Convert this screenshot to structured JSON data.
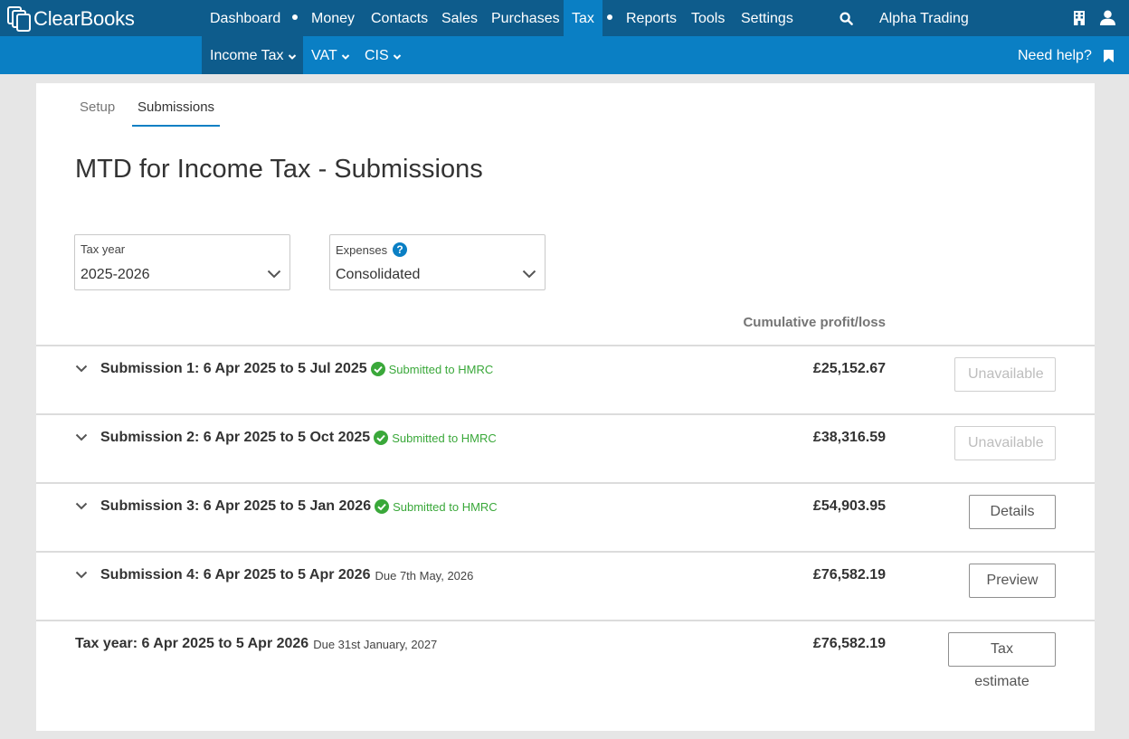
{
  "app": {
    "brand": "ClearBooks",
    "company": "Alpha Trading"
  },
  "topnav": {
    "items": [
      {
        "label": "Dashboard"
      },
      {
        "label": "Money"
      },
      {
        "label": "Contacts"
      },
      {
        "label": "Sales"
      },
      {
        "label": "Purchases"
      },
      {
        "label": "Tax"
      },
      {
        "label": "Reports"
      },
      {
        "label": "Tools"
      },
      {
        "label": "Settings"
      }
    ],
    "active": "Tax"
  },
  "subnav": {
    "items": [
      {
        "label": "Income Tax"
      },
      {
        "label": "VAT"
      },
      {
        "label": "CIS"
      }
    ],
    "active": "Income Tax",
    "help_label": "Need help?"
  },
  "tabs": [
    {
      "label": "Setup"
    },
    {
      "label": "Submissions"
    }
  ],
  "active_tab": "Submissions",
  "page_title": "MTD for Income Tax - Submissions",
  "filters": {
    "tax_year": {
      "label": "Tax year",
      "value": "2025-2026"
    },
    "expenses": {
      "label": "Expenses",
      "value": "Consolidated"
    }
  },
  "table": {
    "column_header": "Cumulative profit/loss",
    "rows": [
      {
        "label": "Submission 1: 6 Apr 2025 to 5 Jul 2025",
        "status": "Submitted to HMRC",
        "amount": "£25,152.67",
        "button": "Unavailable"
      },
      {
        "label": "Submission 2: 6 Apr 2025 to 5 Oct 2025",
        "status": "Submitted to HMRC",
        "amount": "£38,316.59",
        "button": "Unavailable"
      },
      {
        "label": "Submission 3: 6 Apr 2025 to 5 Jan 2026",
        "status": "Submitted to HMRC",
        "amount": "£54,903.95",
        "button": "Details"
      },
      {
        "label": "Submission 4: 6 Apr 2025 to 5 Apr 2026",
        "due": "Due 7th May, 2026",
        "amount": "£76,582.19",
        "button": "Preview"
      }
    ],
    "total": {
      "label": "Tax year: 6 Apr 2025 to 5 Apr 2026",
      "due": "Due 31st January, 2027",
      "amount": "£76,582.19",
      "button": "Tax estimate"
    }
  },
  "colors": {
    "topbar": "#0e5c8c",
    "accent": "#0a7fc4",
    "success": "#3aa83a"
  }
}
